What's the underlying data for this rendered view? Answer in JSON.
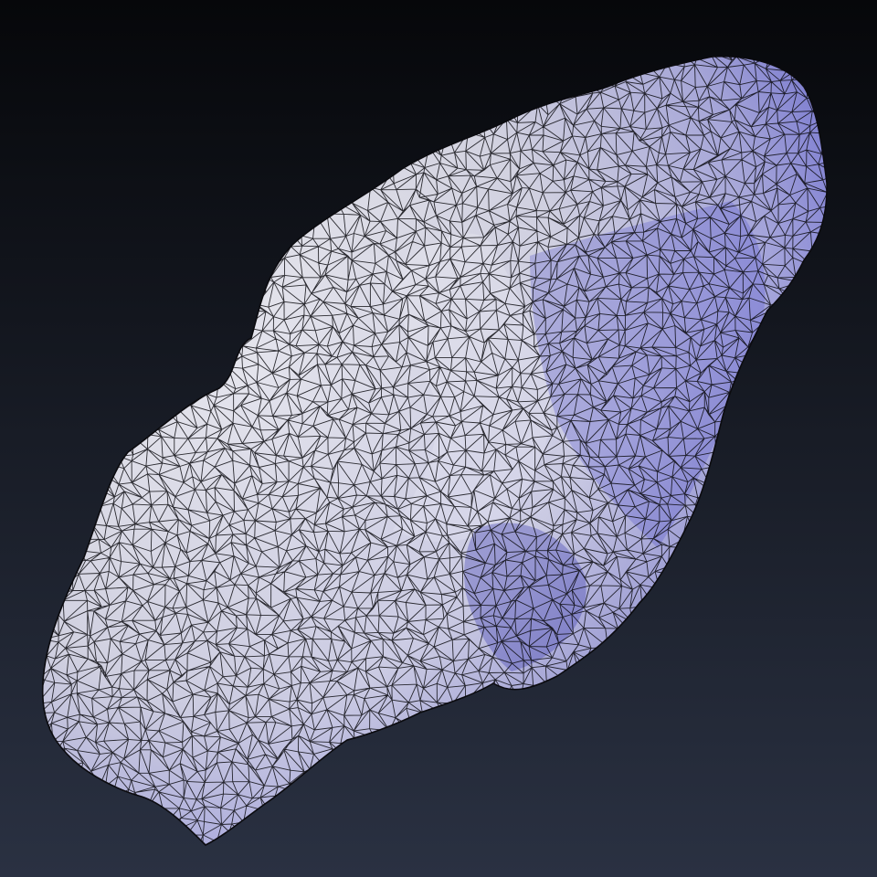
{
  "scene": {
    "background_top": "#06070a",
    "background_bottom": "#2a3142",
    "model": {
      "shading": "wireframe-over-solid",
      "base_color": "#e9e9ef",
      "shadow_color": "#5a5ad0",
      "wire_color": "#0b0b0f"
    }
  }
}
